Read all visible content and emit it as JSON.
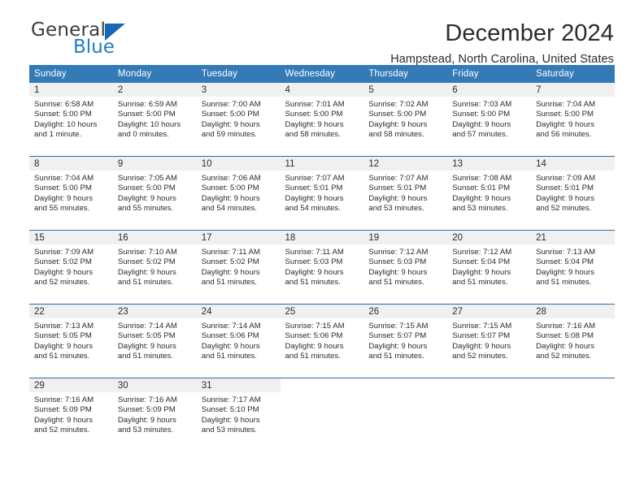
{
  "brand": {
    "name_top": "General",
    "name_bottom": "Blue",
    "triangle_color": "#1668b3",
    "blue_color": "#1b7fc4"
  },
  "header": {
    "title": "December 2024",
    "subtitle": "Hampstead, North Carolina, United States"
  },
  "theme": {
    "header_row_bg": "#337ab7",
    "header_row_text": "#ffffff",
    "daynum_band_bg": "#f0f0f0",
    "row_divider": "#2f6ca8",
    "body_text": "#2b2b2b"
  },
  "weekday_headers": [
    "Sunday",
    "Monday",
    "Tuesday",
    "Wednesday",
    "Thursday",
    "Friday",
    "Saturday"
  ],
  "labels": {
    "sunrise_prefix": "Sunrise:",
    "sunset_prefix": "Sunset:",
    "daylight_prefix": "Daylight:"
  },
  "weeks": [
    [
      {
        "day": "1",
        "sunrise": "Sunrise: 6:58 AM",
        "sunset": "Sunset: 5:00 PM",
        "daylight_line1": "Daylight: 10 hours",
        "daylight_line2": "and 1 minute."
      },
      {
        "day": "2",
        "sunrise": "Sunrise: 6:59 AM",
        "sunset": "Sunset: 5:00 PM",
        "daylight_line1": "Daylight: 10 hours",
        "daylight_line2": "and 0 minutes."
      },
      {
        "day": "3",
        "sunrise": "Sunrise: 7:00 AM",
        "sunset": "Sunset: 5:00 PM",
        "daylight_line1": "Daylight: 9 hours",
        "daylight_line2": "and 59 minutes."
      },
      {
        "day": "4",
        "sunrise": "Sunrise: 7:01 AM",
        "sunset": "Sunset: 5:00 PM",
        "daylight_line1": "Daylight: 9 hours",
        "daylight_line2": "and 58 minutes."
      },
      {
        "day": "5",
        "sunrise": "Sunrise: 7:02 AM",
        "sunset": "Sunset: 5:00 PM",
        "daylight_line1": "Daylight: 9 hours",
        "daylight_line2": "and 58 minutes."
      },
      {
        "day": "6",
        "sunrise": "Sunrise: 7:03 AM",
        "sunset": "Sunset: 5:00 PM",
        "daylight_line1": "Daylight: 9 hours",
        "daylight_line2": "and 57 minutes."
      },
      {
        "day": "7",
        "sunrise": "Sunrise: 7:04 AM",
        "sunset": "Sunset: 5:00 PM",
        "daylight_line1": "Daylight: 9 hours",
        "daylight_line2": "and 56 minutes."
      }
    ],
    [
      {
        "day": "8",
        "sunrise": "Sunrise: 7:04 AM",
        "sunset": "Sunset: 5:00 PM",
        "daylight_line1": "Daylight: 9 hours",
        "daylight_line2": "and 55 minutes."
      },
      {
        "day": "9",
        "sunrise": "Sunrise: 7:05 AM",
        "sunset": "Sunset: 5:00 PM",
        "daylight_line1": "Daylight: 9 hours",
        "daylight_line2": "and 55 minutes."
      },
      {
        "day": "10",
        "sunrise": "Sunrise: 7:06 AM",
        "sunset": "Sunset: 5:00 PM",
        "daylight_line1": "Daylight: 9 hours",
        "daylight_line2": "and 54 minutes."
      },
      {
        "day": "11",
        "sunrise": "Sunrise: 7:07 AM",
        "sunset": "Sunset: 5:01 PM",
        "daylight_line1": "Daylight: 9 hours",
        "daylight_line2": "and 54 minutes."
      },
      {
        "day": "12",
        "sunrise": "Sunrise: 7:07 AM",
        "sunset": "Sunset: 5:01 PM",
        "daylight_line1": "Daylight: 9 hours",
        "daylight_line2": "and 53 minutes."
      },
      {
        "day": "13",
        "sunrise": "Sunrise: 7:08 AM",
        "sunset": "Sunset: 5:01 PM",
        "daylight_line1": "Daylight: 9 hours",
        "daylight_line2": "and 53 minutes."
      },
      {
        "day": "14",
        "sunrise": "Sunrise: 7:09 AM",
        "sunset": "Sunset: 5:01 PM",
        "daylight_line1": "Daylight: 9 hours",
        "daylight_line2": "and 52 minutes."
      }
    ],
    [
      {
        "day": "15",
        "sunrise": "Sunrise: 7:09 AM",
        "sunset": "Sunset: 5:02 PM",
        "daylight_line1": "Daylight: 9 hours",
        "daylight_line2": "and 52 minutes."
      },
      {
        "day": "16",
        "sunrise": "Sunrise: 7:10 AM",
        "sunset": "Sunset: 5:02 PM",
        "daylight_line1": "Daylight: 9 hours",
        "daylight_line2": "and 51 minutes."
      },
      {
        "day": "17",
        "sunrise": "Sunrise: 7:11 AM",
        "sunset": "Sunset: 5:02 PM",
        "daylight_line1": "Daylight: 9 hours",
        "daylight_line2": "and 51 minutes."
      },
      {
        "day": "18",
        "sunrise": "Sunrise: 7:11 AM",
        "sunset": "Sunset: 5:03 PM",
        "daylight_line1": "Daylight: 9 hours",
        "daylight_line2": "and 51 minutes."
      },
      {
        "day": "19",
        "sunrise": "Sunrise: 7:12 AM",
        "sunset": "Sunset: 5:03 PM",
        "daylight_line1": "Daylight: 9 hours",
        "daylight_line2": "and 51 minutes."
      },
      {
        "day": "20",
        "sunrise": "Sunrise: 7:12 AM",
        "sunset": "Sunset: 5:04 PM",
        "daylight_line1": "Daylight: 9 hours",
        "daylight_line2": "and 51 minutes."
      },
      {
        "day": "21",
        "sunrise": "Sunrise: 7:13 AM",
        "sunset": "Sunset: 5:04 PM",
        "daylight_line1": "Daylight: 9 hours",
        "daylight_line2": "and 51 minutes."
      }
    ],
    [
      {
        "day": "22",
        "sunrise": "Sunrise: 7:13 AM",
        "sunset": "Sunset: 5:05 PM",
        "daylight_line1": "Daylight: 9 hours",
        "daylight_line2": "and 51 minutes."
      },
      {
        "day": "23",
        "sunrise": "Sunrise: 7:14 AM",
        "sunset": "Sunset: 5:05 PM",
        "daylight_line1": "Daylight: 9 hours",
        "daylight_line2": "and 51 minutes."
      },
      {
        "day": "24",
        "sunrise": "Sunrise: 7:14 AM",
        "sunset": "Sunset: 5:06 PM",
        "daylight_line1": "Daylight: 9 hours",
        "daylight_line2": "and 51 minutes."
      },
      {
        "day": "25",
        "sunrise": "Sunrise: 7:15 AM",
        "sunset": "Sunset: 5:06 PM",
        "daylight_line1": "Daylight: 9 hours",
        "daylight_line2": "and 51 minutes."
      },
      {
        "day": "26",
        "sunrise": "Sunrise: 7:15 AM",
        "sunset": "Sunset: 5:07 PM",
        "daylight_line1": "Daylight: 9 hours",
        "daylight_line2": "and 51 minutes."
      },
      {
        "day": "27",
        "sunrise": "Sunrise: 7:15 AM",
        "sunset": "Sunset: 5:07 PM",
        "daylight_line1": "Daylight: 9 hours",
        "daylight_line2": "and 52 minutes."
      },
      {
        "day": "28",
        "sunrise": "Sunrise: 7:16 AM",
        "sunset": "Sunset: 5:08 PM",
        "daylight_line1": "Daylight: 9 hours",
        "daylight_line2": "and 52 minutes."
      }
    ],
    [
      {
        "day": "29",
        "sunrise": "Sunrise: 7:16 AM",
        "sunset": "Sunset: 5:09 PM",
        "daylight_line1": "Daylight: 9 hours",
        "daylight_line2": "and 52 minutes."
      },
      {
        "day": "30",
        "sunrise": "Sunrise: 7:16 AM",
        "sunset": "Sunset: 5:09 PM",
        "daylight_line1": "Daylight: 9 hours",
        "daylight_line2": "and 53 minutes."
      },
      {
        "day": "31",
        "sunrise": "Sunrise: 7:17 AM",
        "sunset": "Sunset: 5:10 PM",
        "daylight_line1": "Daylight: 9 hours",
        "daylight_line2": "and 53 minutes."
      },
      {
        "day": "",
        "sunrise": "",
        "sunset": "",
        "daylight_line1": "",
        "daylight_line2": ""
      },
      {
        "day": "",
        "sunrise": "",
        "sunset": "",
        "daylight_line1": "",
        "daylight_line2": ""
      },
      {
        "day": "",
        "sunrise": "",
        "sunset": "",
        "daylight_line1": "",
        "daylight_line2": ""
      },
      {
        "day": "",
        "sunrise": "",
        "sunset": "",
        "daylight_line1": "",
        "daylight_line2": ""
      }
    ]
  ]
}
